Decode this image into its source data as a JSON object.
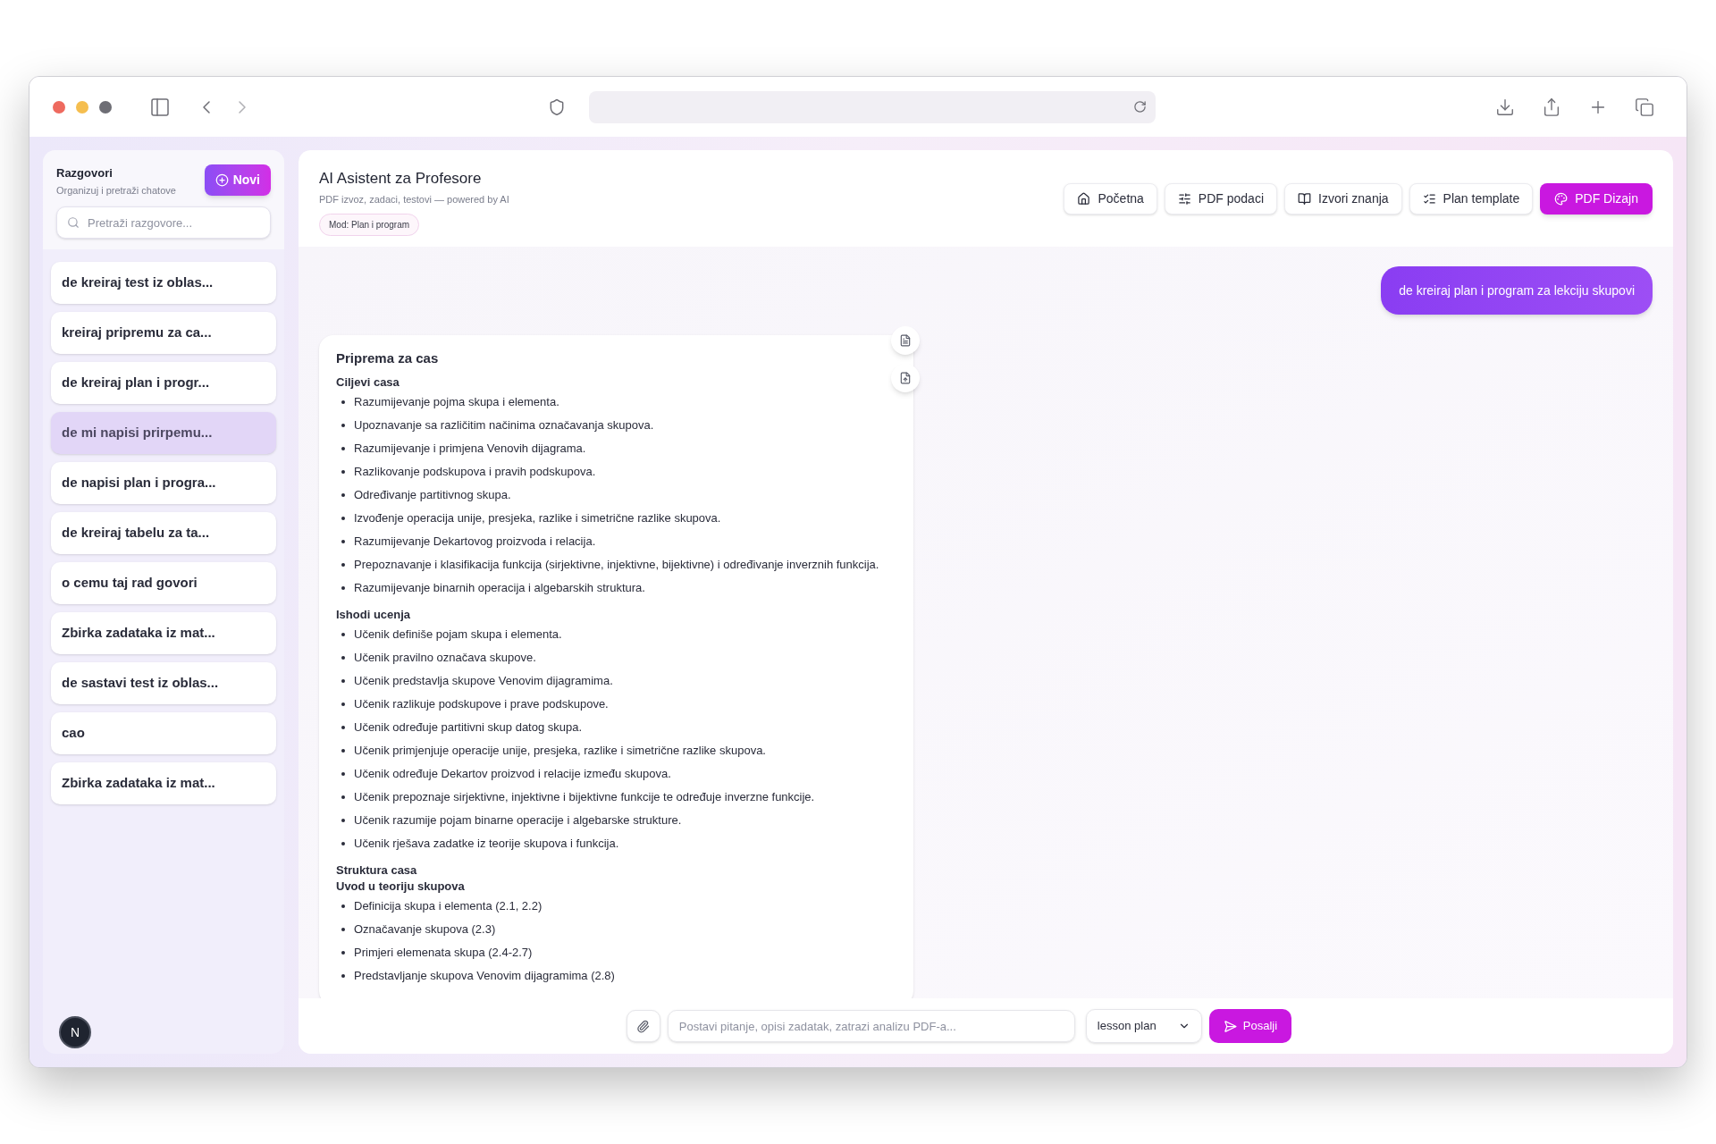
{
  "sidebar": {
    "title": "Razgovori",
    "subtitle": "Organizuj i pretraži chatove",
    "new_button": "Novi",
    "search_placeholder": "Pretraži razgovore...",
    "conversations": [
      {
        "label": "de kreiraj test iz oblas...",
        "selected": false
      },
      {
        "label": "kreiraj pripremu za ca...",
        "selected": false
      },
      {
        "label": "de kreiraj plan i progr...",
        "selected": false
      },
      {
        "label": "de mi napisi prirpemu...",
        "selected": true
      },
      {
        "label": "de napisi plan i progra...",
        "selected": false
      },
      {
        "label": "de kreiraj tabelu za ta...",
        "selected": false
      },
      {
        "label": "o cemu taj rad govori",
        "selected": false
      },
      {
        "label": "Zbirka zadataka iz mat...",
        "selected": false
      },
      {
        "label": "de sastavi test iz oblas...",
        "selected": false
      },
      {
        "label": "cao",
        "selected": false
      },
      {
        "label": "Zbirka zadataka iz mat...",
        "selected": false
      }
    ],
    "avatar_letter": "N"
  },
  "header": {
    "title": "AI Asistent za Profesore",
    "subtitle": "PDF izvoz, zadaci, testovi — powered by AI",
    "mode_badge": "Mod: Plan i program",
    "nav": [
      {
        "label": "Početna",
        "selected": false
      },
      {
        "label": "PDF podaci",
        "selected": false
      },
      {
        "label": "Izvori znanja",
        "selected": false
      },
      {
        "label": "Plan template",
        "selected": false
      },
      {
        "label": "PDF Dizajn",
        "selected": true
      }
    ]
  },
  "chat": {
    "user_message": "de kreiraj plan i program za lekciju skupovi",
    "assistant": {
      "title": "Priprema za cas",
      "sections": [
        {
          "headings": [
            "Ciljevi casa"
          ],
          "items": [
            "Razumijevanje pojma skupa i elementa.",
            "Upoznavanje sa različitim načinima označavanja skupova.",
            "Razumijevanje i primjena Venovih dijagrama.",
            "Razlikovanje podskupova i pravih podskupova.",
            "Određivanje partitivnog skupa.",
            "Izvođenje operacija unije, presjeka, razlike i simetrične razlike skupova.",
            "Razumijevanje Dekartovog proizvoda i relacija.",
            "Prepoznavanje i klasifikacija funkcija (sirjektivne, injektivne, bijektivne) i određivanje inverznih funkcija.",
            "Razumijevanje binarnih operacija i algebarskih struktura."
          ]
        },
        {
          "headings": [
            "Ishodi ucenja"
          ],
          "items": [
            "Učenik definiše pojam skupa i elementa.",
            "Učenik pravilno označava skupove.",
            "Učenik predstavlja skupove Venovim dijagramima.",
            "Učenik razlikuje podskupove i prave podskupove.",
            "Učenik određuje partitivni skup datog skupa.",
            "Učenik primjenjuje operacije unije, presjeka, razlike i simetrične razlike skupova.",
            "Učenik određuje Dekartov proizvod i relacije između skupova.",
            "Učenik prepoznaje sirjektivne, injektivne i bijektivne funkcije te određuje inverzne funkcije.",
            "Učenik razumije pojam binarne operacije i algebarske strukture.",
            "Učenik rješava zadatke iz teorije skupova i funkcija."
          ]
        },
        {
          "headings": [
            "Struktura casa",
            "Uvod u teoriju skupova"
          ],
          "items": [
            "Definicija skupa i elementa (2.1, 2.2)",
            "Označavanje skupova (2.3)",
            "Primjeri elemenata skupa (2.4-2.7)",
            "Predstavljanje skupova Venovim dijagramima (2.8)"
          ]
        }
      ]
    }
  },
  "composer": {
    "placeholder": "Postavi pitanje, opisi zadatak, zatrazi analizu PDF-a...",
    "mode": "lesson plan",
    "send_button": "Posalji"
  }
}
